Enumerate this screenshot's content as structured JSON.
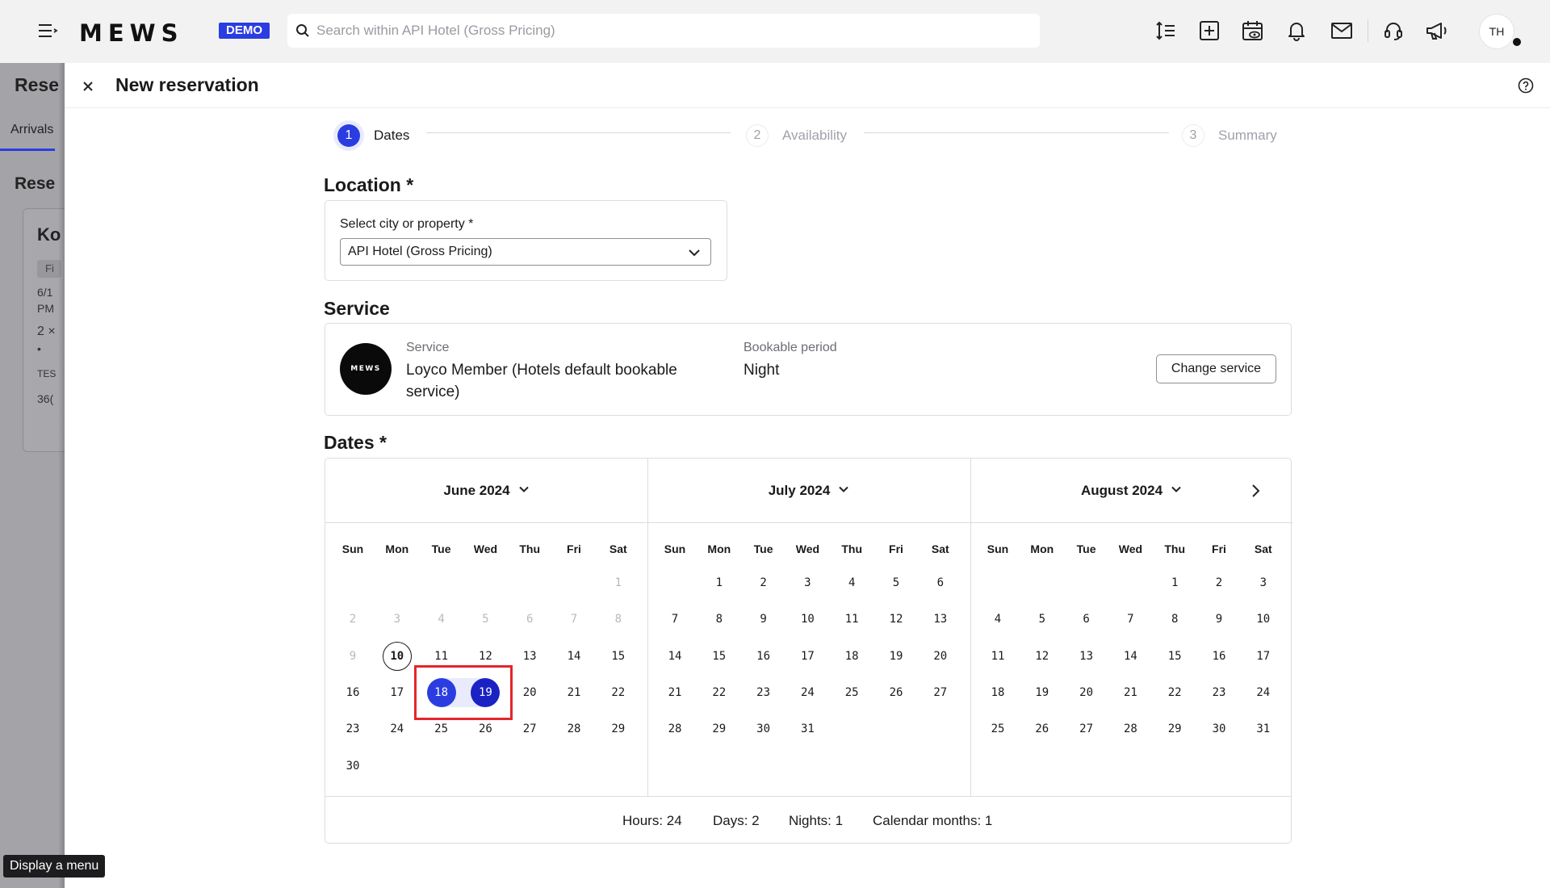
{
  "app": {
    "logo": "MEWS",
    "demo_badge": "DEMO",
    "search_placeholder": "Search within API Hotel (Gross Pricing)",
    "avatar_initials": "TH",
    "toolbar_icons": [
      "sort-lines-icon",
      "add-box-icon",
      "calendar-eye-icon",
      "bell-icon",
      "mail-icon",
      "headset-icon",
      "megaphone-icon"
    ]
  },
  "background_page": {
    "title": "Rese",
    "tab": "Arrivals",
    "subtitle": "Rese",
    "card_title": "Ko",
    "card_chip": "Fi",
    "card_lines": [
      "6/1",
      "PM",
      "2 ×",
      "•",
      "TES",
      "36("
    ]
  },
  "tooltip": "Display a menu",
  "panel": {
    "title": "New reservation",
    "steps": [
      {
        "num": "1",
        "label": "Dates",
        "active": true
      },
      {
        "num": "2",
        "label": "Availability",
        "active": false
      },
      {
        "num": "3",
        "label": "Summary",
        "active": false
      }
    ],
    "location": {
      "section_title": "Location *",
      "field_label": "Select city or property *",
      "selected": "API Hotel (Gross Pricing)"
    },
    "service": {
      "section_title": "Service",
      "logo_text": "MEWS",
      "service_caption": "Service",
      "service_value": "Loyco Member (Hotels default bookable service)",
      "period_caption": "Bookable period",
      "period_value": "Night",
      "change_button": "Change service"
    },
    "dates": {
      "section_title": "Dates *",
      "weekdays": [
        "Sun",
        "Mon",
        "Tue",
        "Wed",
        "Thu",
        "Fri",
        "Sat"
      ],
      "months": [
        {
          "label": "June 2024",
          "first_weekday": 6,
          "days": 30,
          "disabled_until": 9,
          "today": 10,
          "selected_start": 18,
          "selected_end": 19
        },
        {
          "label": "July 2024",
          "first_weekday": 1,
          "days": 31
        },
        {
          "label": "August 2024",
          "first_weekday": 4,
          "days": 31
        }
      ],
      "summary": {
        "hours": "Hours: 24",
        "days": "Days: 2",
        "nights": "Nights: 1",
        "months": "Calendar months: 1"
      }
    }
  },
  "colors": {
    "accent": "#2b3de0",
    "selected_end": "#1b22c4",
    "range_band": "#e9ebfd",
    "highlight_box": "#e3262c"
  }
}
